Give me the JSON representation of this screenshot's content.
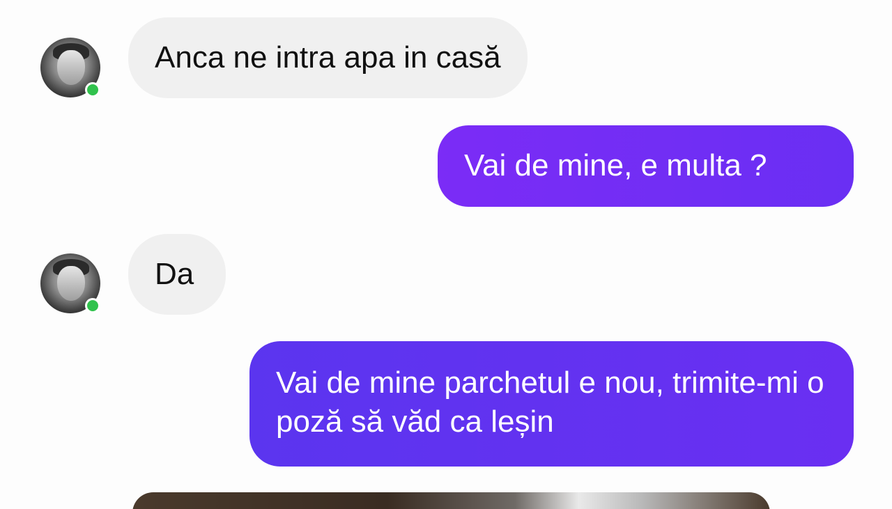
{
  "conversation": {
    "messages": [
      {
        "side": "incoming",
        "text": "Anca ne intra apa in casă"
      },
      {
        "side": "outgoing",
        "text": "Vai de mine, e multa ?"
      },
      {
        "side": "incoming",
        "text": "Da"
      },
      {
        "side": "outgoing",
        "text": "Vai de mine parchetul e nou, trimite-mi o poză să văd ca leșin"
      }
    ],
    "contact_status": "online"
  },
  "colors": {
    "incoming_bubble": "#f0f0f0",
    "outgoing_bubble": "#6a2ff3",
    "online_dot": "#31c24d"
  },
  "icons": {
    "avatar": "contact-avatar-photo",
    "status": "online-dot-icon"
  }
}
